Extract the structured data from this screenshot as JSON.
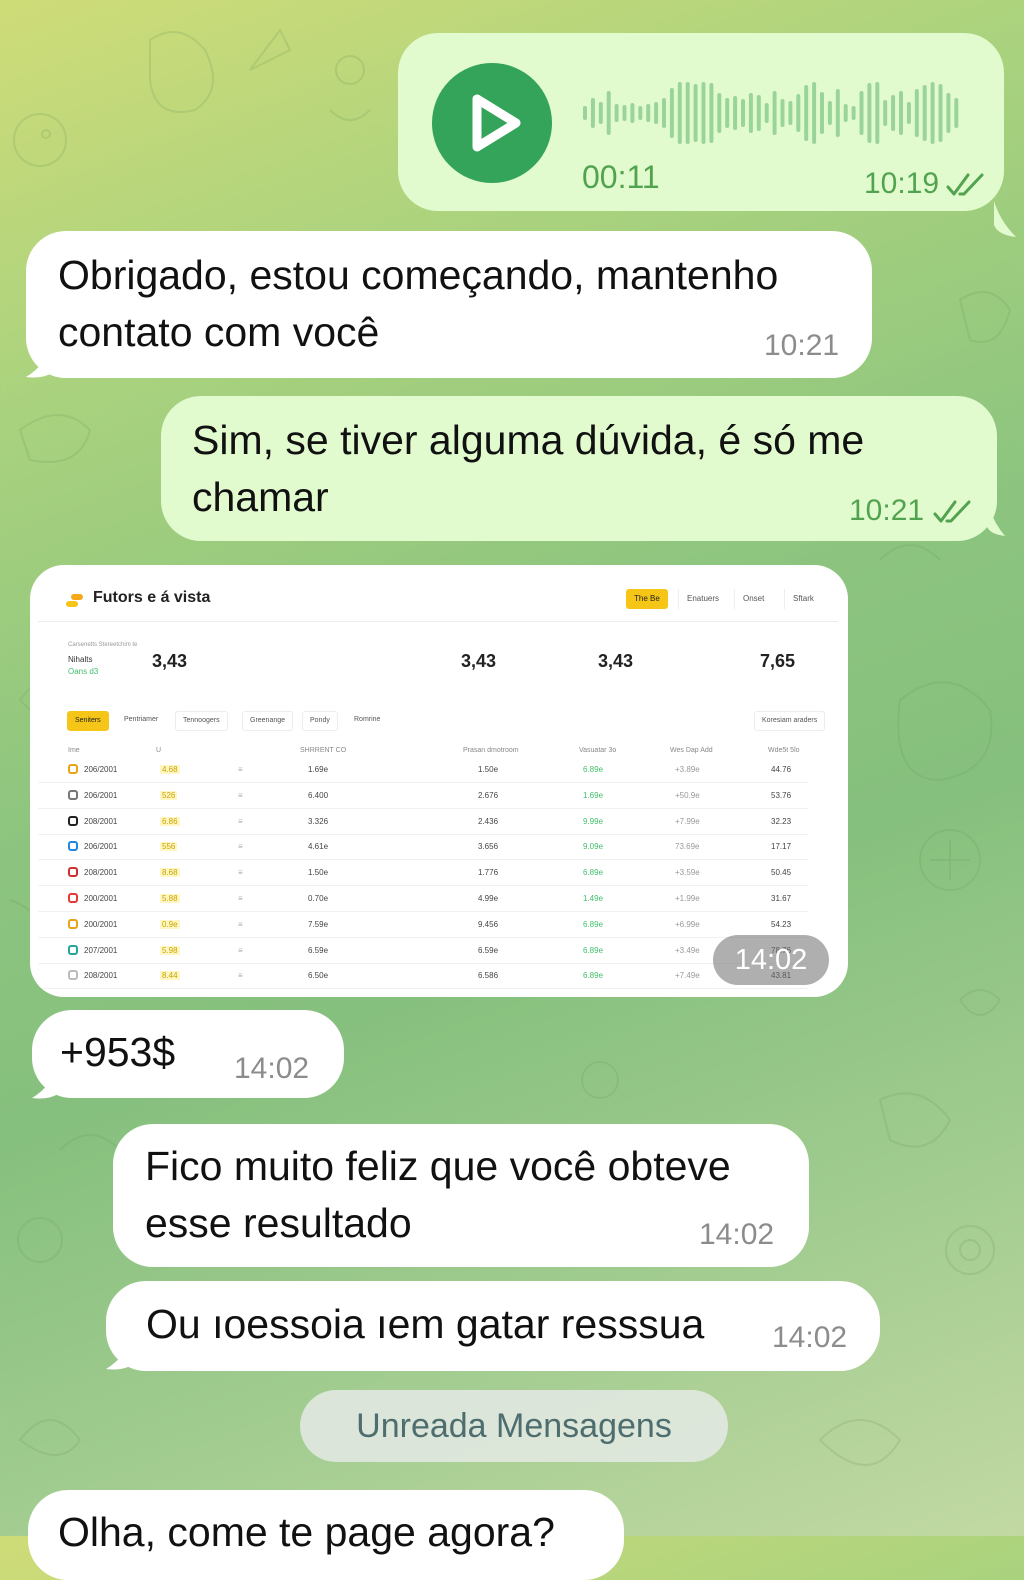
{
  "colors": {
    "outgoing_bubble": "#e1fbcf",
    "incoming_bubble": "#ffffff",
    "accent_green": "#34a45a",
    "time_green": "#52a34f",
    "time_gray": "#8c8c8c"
  },
  "messages": {
    "voice": {
      "duration": "00:11",
      "time": "10:19",
      "status": "read",
      "play_icon": "play-icon"
    },
    "m1": {
      "line1": "Obrigado, estou começando, mantenho",
      "line2": "contato com você",
      "time": "10:21"
    },
    "m2": {
      "line1": "Sim, se tiver alguma dúvida, é só me",
      "line2": "chamar",
      "time": "10:21",
      "status": "read"
    },
    "image_msg": {
      "time": "14:02"
    },
    "m3": {
      "text": "+953$",
      "time": "14:02"
    },
    "m4": {
      "line1": "Fico muito feliz que você obteve",
      "line2": "esse resultado",
      "time": "14:02"
    },
    "m5": {
      "text": "Ou ıoessoia ıem gatar resssua",
      "time": "14:02"
    },
    "m6": {
      "text": "Olha, come te page agora?"
    }
  },
  "unread_divider": "Unreada Mensagens",
  "screenshot": {
    "title": "Futors e á vista",
    "top_tabs": [
      "The Be",
      "Enatuers",
      "Onset",
      "Sftark"
    ],
    "subheader": "Carsenetts Stereetchim te",
    "left_label": "Nihalts",
    "left_sub": "Oans d3",
    "stats": [
      "3,43",
      "3,43",
      "3,43",
      "7,65"
    ],
    "filters": [
      "Seniters",
      "Pentriamer",
      "Tennoogers",
      "Greenange",
      "Pondy",
      "Romrine"
    ],
    "filter_right": "Koresiam araders",
    "columns": [
      "Ime",
      "U",
      "SHRRENT CO",
      "Prasan dmotroom",
      "Vasuatar 3o",
      "Wes Dap Add",
      "Wde5t 5lo"
    ],
    "rows": [
      {
        "date": "206/2001",
        "pct": "4.68",
        "c1": "1.69e",
        "c2": "1.50e",
        "c3": "6.89e",
        "c4": "+3.89e",
        "c5": "44.76",
        "coin": "#e8a317"
      },
      {
        "date": "206/2001",
        "pct": "526",
        "c1": "6.400",
        "c2": "2.676",
        "c3": "1.69e",
        "c4": "+50.9e",
        "c5": "53.76",
        "coin": "#777777"
      },
      {
        "date": "208/2001",
        "pct": "6.86",
        "c1": "3.326",
        "c2": "2.436",
        "c3": "9.99e",
        "c4": "+7.99e",
        "c5": "32.23",
        "coin": "#222222"
      },
      {
        "date": "206/2001",
        "pct": "556",
        "c1": "4.61e",
        "c2": "3.656",
        "c3": "9.09e",
        "c4": "73.69e",
        "c5": "17.17",
        "coin": "#1e88e5"
      },
      {
        "date": "208/2001",
        "pct": "8.68",
        "c1": "1.50e",
        "c2": "1.776",
        "c3": "6.89e",
        "c4": "+3.59e",
        "c5": "50.45",
        "coin": "#d32f2f"
      },
      {
        "date": "200/2001",
        "pct": "5.88",
        "c1": "0.70e",
        "c2": "4.99e",
        "c3": "1.49e",
        "c4": "+1.99e",
        "c5": "31.67",
        "coin": "#e53935"
      },
      {
        "date": "200/2001",
        "pct": "0.9e",
        "c1": "7.59e",
        "c2": "9.456",
        "c3": "6.89e",
        "c4": "+6.99e",
        "c5": "54.23",
        "coin": "#e8a317"
      },
      {
        "date": "207/2001",
        "pct": "5.98",
        "c1": "6.59e",
        "c2": "6.59e",
        "c3": "6.89e",
        "c4": "+3.49e",
        "c5": "78.76",
        "coin": "#26a69a"
      },
      {
        "date": "208/2001",
        "pct": "8.44",
        "c1": "6.50e",
        "c2": "6.586",
        "c3": "6.89e",
        "c4": "+7.49e",
        "c5": "43.81",
        "coin": "#bbbbbb"
      }
    ]
  }
}
